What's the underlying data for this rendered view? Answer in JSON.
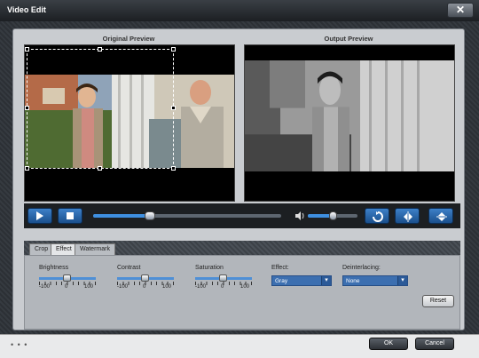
{
  "window": {
    "title": "Video Edit",
    "close_glyph": "✕"
  },
  "preview": {
    "original_label": "Original Preview",
    "output_label": "Output Preview",
    "seek_progress": 0.3,
    "volume_level": 0.5
  },
  "tabs": [
    {
      "label": "Crop",
      "active": false
    },
    {
      "label": "Effect",
      "active": true
    },
    {
      "label": "Watermark",
      "active": false
    }
  ],
  "effect": {
    "brightness": {
      "label": "Brightness",
      "min": "-100",
      "mid": "0",
      "max": "100",
      "value": 0
    },
    "contrast": {
      "label": "Contrast",
      "min": "-100",
      "mid": "0",
      "max": "100",
      "value": 0
    },
    "saturation": {
      "label": "Saturation",
      "min": "-100",
      "mid": "0",
      "max": "100",
      "value": 0
    },
    "effect_select": {
      "label": "Effect:",
      "value": "Gray"
    },
    "deinterlacing_select": {
      "label": "Deinterlacing:",
      "value": "None"
    },
    "reset_label": "Reset"
  },
  "footer": {
    "dots": "• • •",
    "ok_label": "OK",
    "cancel_label": "Cancel"
  },
  "colors": {
    "accent": "#3e8fe0",
    "button_blue": "#2a67ad",
    "frame_dark": "#2c3035"
  }
}
